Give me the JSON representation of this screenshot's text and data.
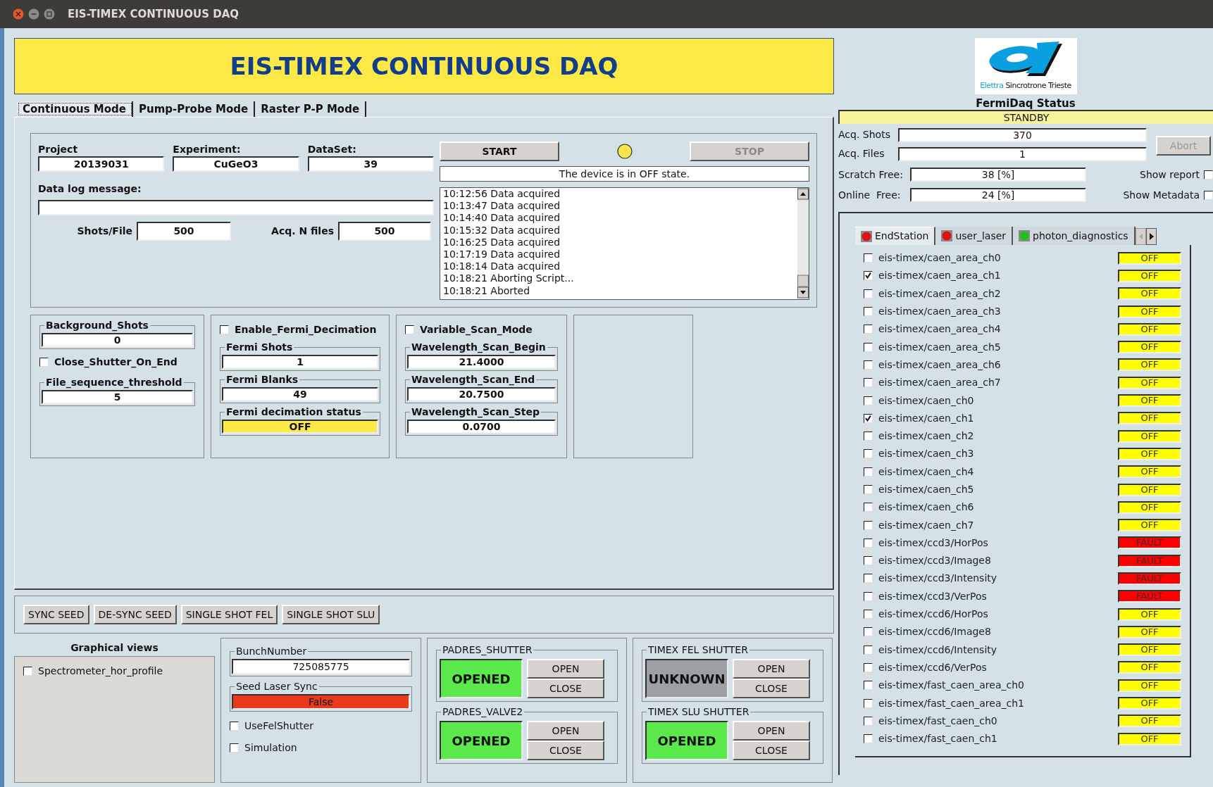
{
  "window": {
    "title": "EIS-TIMEX CONTINUOUS DAQ"
  },
  "banner": "EIS-TIMEX CONTINUOUS DAQ",
  "mode_tabs": [
    {
      "label": "Continuous Mode",
      "selected": true
    },
    {
      "label": "Pump-Probe Mode",
      "selected": false
    },
    {
      "label": "Raster P-P Mode",
      "selected": false
    }
  ],
  "run": {
    "fields": [
      {
        "label": "Project",
        "value": "20139031"
      },
      {
        "label": "Experiment:",
        "value": "CuGeO3"
      },
      {
        "label": "DataSet:",
        "value": "39"
      }
    ],
    "log_message": {
      "label": "Data log message:"
    },
    "shots_per_file": {
      "label": "Shots/File",
      "value": "500"
    },
    "acq_n_files": {
      "label": "Acq. N files",
      "value": "500"
    },
    "start": {
      "label": "START",
      "disabled": false
    },
    "stop": {
      "label": "STOP",
      "disabled": true
    },
    "device_state": "The device is in OFF state.",
    "log": [
      "10:12:56 Data acquired",
      "10:13:47 Data acquired",
      "10:14:40 Data acquired",
      "10:15:32 Data acquired",
      "10:16:25 Data acquired",
      "10:17:19 Data acquired",
      "10:18:14 Data acquired",
      "10:18:21 Aborting Script...",
      "10:18:21 Aborted"
    ]
  },
  "background": {
    "background_shots": {
      "label": "Background_Shots",
      "value": "0"
    },
    "close_shutter": {
      "label": "Close_Shutter_On_End",
      "checked": false
    },
    "file_sequence_threshold": {
      "label": "File_sequence_threshold",
      "value": "5"
    }
  },
  "decimation": {
    "enable": {
      "label": "Enable_Fermi_Decimation",
      "checked": false
    },
    "fermi_shots": {
      "label": "Fermi Shots",
      "value": "1"
    },
    "fermi_blanks": {
      "label": "Fermi Blanks",
      "value": "49"
    },
    "status": {
      "label": "Fermi decimation status",
      "value": "OFF"
    }
  },
  "scan": {
    "variable": {
      "label": "Variable_Scan_Mode",
      "checked": false
    },
    "fields": [
      {
        "label": "Wavelength_Scan_Begin",
        "value": "21.4000"
      },
      {
        "label": "Wavelength_Scan_End",
        "value": "20.7500"
      },
      {
        "label": "Wavelength_Scan_Step",
        "value": "0.0700"
      }
    ]
  },
  "action_buttons": [
    "SYNC SEED",
    "DE-SYNC SEED",
    "SINGLE SHOT FEL",
    "SINGLE SHOT SLU"
  ],
  "graphical_views": {
    "title": "Graphical views",
    "items": [
      {
        "label": "Spectrometer_hor_profile",
        "checked": false
      }
    ]
  },
  "sync": {
    "bunch_number": {
      "label": "BunchNumber",
      "value": "725085775"
    },
    "seed_laser_sync": {
      "label": "Seed Laser Sync",
      "value": "False"
    },
    "options": [
      {
        "label": "UseFelShutter",
        "checked": false
      },
      {
        "label": "Simulation",
        "checked": false
      }
    ]
  },
  "shutters": [
    {
      "name": "PADRES_SHUTTER",
      "state": "OPENED",
      "color": "#5be84b",
      "open": "OPEN",
      "close": "CLOSE"
    },
    {
      "name": "PADRES_VALVE2",
      "state": "OPENED",
      "color": "#5be84b",
      "open": "OPEN",
      "close": "CLOSE"
    },
    {
      "name": "TIMEX FEL SHUTTER",
      "state": "UNKNOWN",
      "color": "#9ba0a4",
      "open": "OPEN",
      "close": "CLOSE"
    },
    {
      "name": "TIMEX SLU SHUTTER",
      "state": "OPENED",
      "color": "#5be84b",
      "open": "OPEN",
      "close": "CLOSE"
    }
  ],
  "status": {
    "logo": {
      "brand": "Elettra",
      "tagline": "Sincrotrone Trieste"
    },
    "title": "FermiDaq Status",
    "state": "STANDBY",
    "counters": [
      {
        "label": "Acq. Shots",
        "value": "370"
      },
      {
        "label": "Acq. Files",
        "value": "1"
      }
    ],
    "abort": {
      "label": "Abort",
      "disabled": true
    },
    "storage": [
      {
        "label": "Scratch Free:",
        "value": "38 [%]",
        "option": {
          "label": "Show report",
          "checked": false
        }
      },
      {
        "label": "Online  Free:",
        "value": "24 [%]",
        "option": {
          "label": "Show Metadata",
          "checked": false
        }
      }
    ]
  },
  "devices": {
    "tabs": [
      {
        "label": "EndStation",
        "selected": true,
        "color": "#e01010"
      },
      {
        "label": "user_laser",
        "selected": false,
        "color": "#e01010"
      },
      {
        "label": "photon_diagnostics",
        "selected": false,
        "color": "#20c020"
      }
    ],
    "items": [
      {
        "name": "eis-timex/caen_area_ch0",
        "checked": false,
        "state": "OFF",
        "color": "#ffff00"
      },
      {
        "name": "eis-timex/caen_area_ch1",
        "checked": true,
        "state": "OFF",
        "color": "#ffff00"
      },
      {
        "name": "eis-timex/caen_area_ch2",
        "checked": false,
        "state": "OFF",
        "color": "#ffff00"
      },
      {
        "name": "eis-timex/caen_area_ch3",
        "checked": false,
        "state": "OFF",
        "color": "#ffff00"
      },
      {
        "name": "eis-timex/caen_area_ch4",
        "checked": false,
        "state": "OFF",
        "color": "#ffff00"
      },
      {
        "name": "eis-timex/caen_area_ch5",
        "checked": false,
        "state": "OFF",
        "color": "#ffff00"
      },
      {
        "name": "eis-timex/caen_area_ch6",
        "checked": false,
        "state": "OFF",
        "color": "#ffff00"
      },
      {
        "name": "eis-timex/caen_area_ch7",
        "checked": false,
        "state": "OFF",
        "color": "#ffff00"
      },
      {
        "name": "eis-timex/caen_ch0",
        "checked": false,
        "state": "OFF",
        "color": "#ffff00"
      },
      {
        "name": "eis-timex/caen_ch1",
        "checked": true,
        "state": "OFF",
        "color": "#ffff00"
      },
      {
        "name": "eis-timex/caen_ch2",
        "checked": false,
        "state": "OFF",
        "color": "#ffff00"
      },
      {
        "name": "eis-timex/caen_ch3",
        "checked": false,
        "state": "OFF",
        "color": "#ffff00"
      },
      {
        "name": "eis-timex/caen_ch4",
        "checked": false,
        "state": "OFF",
        "color": "#ffff00"
      },
      {
        "name": "eis-timex/caen_ch5",
        "checked": false,
        "state": "OFF",
        "color": "#ffff00"
      },
      {
        "name": "eis-timex/caen_ch6",
        "checked": false,
        "state": "OFF",
        "color": "#ffff00"
      },
      {
        "name": "eis-timex/caen_ch7",
        "checked": false,
        "state": "OFF",
        "color": "#ffff00"
      },
      {
        "name": "eis-timex/ccd3/HorPos",
        "checked": false,
        "state": "FAULT",
        "color": "#ff0000"
      },
      {
        "name": "eis-timex/ccd3/Image8",
        "checked": false,
        "state": "FAULT",
        "color": "#ff0000"
      },
      {
        "name": "eis-timex/ccd3/Intensity",
        "checked": false,
        "state": "FAULT",
        "color": "#ff0000"
      },
      {
        "name": "eis-timex/ccd3/VerPos",
        "checked": false,
        "state": "FAULT",
        "color": "#ff0000"
      },
      {
        "name": "eis-timex/ccd6/HorPos",
        "checked": false,
        "state": "OFF",
        "color": "#ffff00"
      },
      {
        "name": "eis-timex/ccd6/Image8",
        "checked": false,
        "state": "OFF",
        "color": "#ffff00"
      },
      {
        "name": "eis-timex/ccd6/Intensity",
        "checked": false,
        "state": "OFF",
        "color": "#ffff00"
      },
      {
        "name": "eis-timex/ccd6/VerPos",
        "checked": false,
        "state": "OFF",
        "color": "#ffff00"
      },
      {
        "name": "eis-timex/fast_caen_area_ch0",
        "checked": false,
        "state": "OFF",
        "color": "#ffff00"
      },
      {
        "name": "eis-timex/fast_caen_area_ch1",
        "checked": false,
        "state": "OFF",
        "color": "#ffff00"
      },
      {
        "name": "eis-timex/fast_caen_ch0",
        "checked": false,
        "state": "OFF",
        "color": "#ffff00"
      },
      {
        "name": "eis-timex/fast_caen_ch1",
        "checked": false,
        "state": "OFF",
        "color": "#ffff00"
      }
    ]
  }
}
